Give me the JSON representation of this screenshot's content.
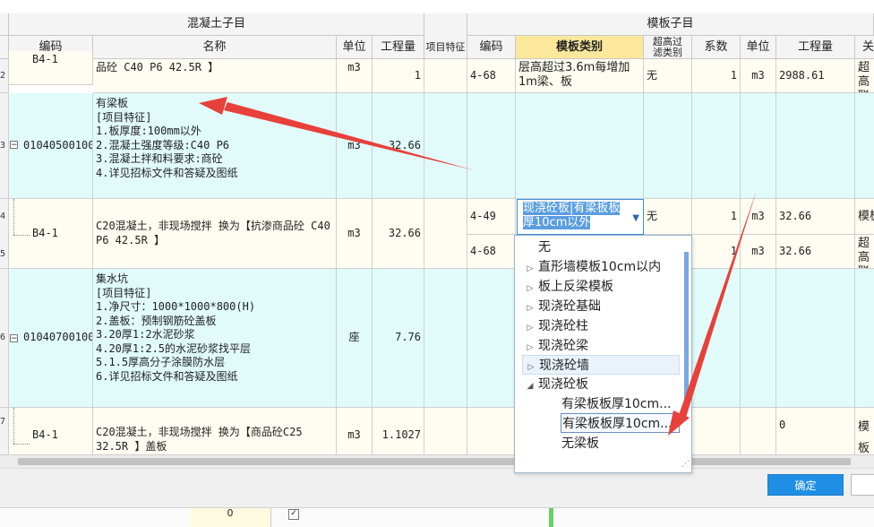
{
  "header": {
    "concrete_group": "混凝土子目",
    "formwork_group": "模板子目",
    "columns": {
      "code": "编码",
      "name": "名称",
      "unit": "单位",
      "qty": "工程量",
      "feature": "项目特征",
      "f_code": "编码",
      "f_type": "模板类别",
      "f_over": "超高过滤类别",
      "f_coef": "系数",
      "f_unit": "单位",
      "f_qty": "工程量",
      "f_rel": "关"
    }
  },
  "rows": [
    {
      "num": "2",
      "code": "B4-1",
      "name": "品砼 C40 P6 42.5R 】",
      "unit": "m3",
      "qty": "1",
      "f_code": "4-68",
      "f_type": "层高超过3.6m每增加1m梁、板",
      "f_over": "无",
      "f_coef": "1",
      "f_unit": "m3",
      "f_qty": "2988.61",
      "f_rel": "超高联"
    },
    {
      "num": "3",
      "code": "010405001003",
      "name_lines": [
        "有梁板",
        "[项目特征]",
        "1.板厚度:100mm以外",
        "2.混凝土强度等级:C40 P6",
        "3.混凝土拌和料要求:商砼",
        "4.详见招标文件和答疑及图纸"
      ],
      "unit": "m3",
      "qty": "32.66"
    },
    {
      "num": "4",
      "code": "B4-1",
      "name": "C20混凝土，非现场搅拌  换为【抗渗商品砼 C40 P6 42.5R 】",
      "unit": "m3",
      "qty": "32.66",
      "f_code": "4-49",
      "f_over": "无",
      "f_coef": "1",
      "f_unit": "m3",
      "f_qty": "32.66",
      "f_rel": "模板"
    },
    {
      "num": "5",
      "f_code": "4-68",
      "f_coef": "1",
      "f_unit": "m3",
      "f_qty": "32.66",
      "f_rel": "超高联"
    },
    {
      "num": "6",
      "code": "010407001001",
      "name_lines": [
        "集水坑",
        "[项目特征]",
        "1.净尺寸：1000*1000*800(H)",
        "2.盖板：预制钢筋砼盖板",
        "3.20厚1:2水泥砂浆",
        "4.20厚1:2.5的水泥砂浆找平层",
        "5.1.5厚高分子涂膜防水层",
        "6.详见招标文件和答疑及图纸"
      ],
      "unit": "座",
      "qty": "7.76"
    },
    {
      "num": "7",
      "code": "B4-1",
      "name": "C20混凝土，非现场搅拌  换为【商品砼C25 32.5R 】盖板",
      "unit": "m3",
      "qty": "1.1027",
      "f_qty": "0",
      "f_rel": "模板",
      "f_rel2": "超"
    }
  ],
  "combo": {
    "value": "现浇砼板|有梁板板厚10cm以外"
  },
  "dropdown": {
    "items": [
      {
        "label": "无",
        "level": 0,
        "tri": ""
      },
      {
        "label": "直形墙模板10cm以内",
        "level": 0,
        "tri": "▷"
      },
      {
        "label": "板上反梁模板",
        "level": 0,
        "tri": "▷"
      },
      {
        "label": "现浇砼基础",
        "level": 0,
        "tri": "▷"
      },
      {
        "label": "现浇砼柱",
        "level": 0,
        "tri": "▷"
      },
      {
        "label": "现浇砼梁",
        "level": 0,
        "tri": "▷"
      },
      {
        "label": "现浇砼墙",
        "level": 0,
        "tri": "▷"
      },
      {
        "label": "现浇砼板",
        "level": 0,
        "tri": "◢"
      },
      {
        "label": "有梁板板厚10cm...",
        "level": 1,
        "tri": ""
      },
      {
        "label": "有梁板板厚10cm...",
        "level": 1,
        "tri": ""
      },
      {
        "label": "无梁板",
        "level": 1,
        "tri": ""
      }
    ]
  },
  "footer": {
    "ok": "确定",
    "bottom_value": "0"
  },
  "colors": {
    "accent": "#1f8fe5",
    "annotation": "#e8403a",
    "highlight": "#fbe89a",
    "row_cyan": "#e1fbfb"
  }
}
